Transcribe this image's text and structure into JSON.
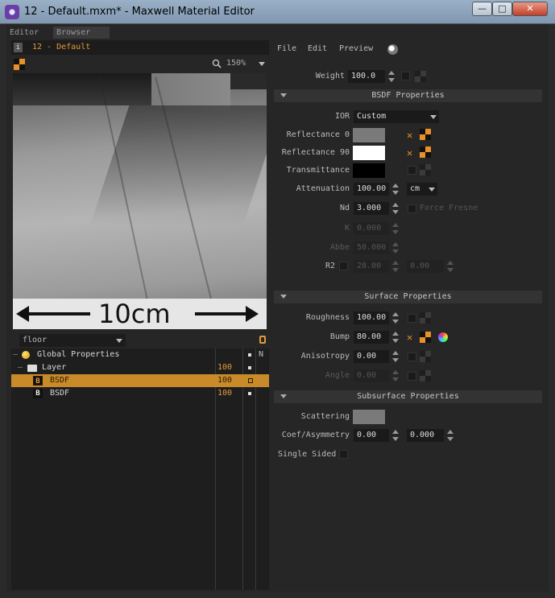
{
  "window": {
    "title": "12 - Default.mxm* - Maxwell Material Editor",
    "minimize": "—",
    "maximize": "□",
    "close": "✕"
  },
  "tabs": [
    "Editor",
    "Browser"
  ],
  "material": {
    "name": "12 - Default",
    "zoom": "150%"
  },
  "preview": {
    "scale_label": "10cm"
  },
  "layers": {
    "dropdown": "floor",
    "rows": [
      {
        "label": "Global Properties",
        "pct": "",
        "n": "N"
      },
      {
        "label": "Layer",
        "pct": "100",
        "n": ""
      },
      {
        "label": "BSDF",
        "pct": "100",
        "n": "",
        "badge": "B"
      },
      {
        "label": "BSDF",
        "pct": "100",
        "n": "",
        "badge": "B"
      }
    ]
  },
  "menu": [
    "File",
    "Edit",
    "Preview"
  ],
  "weight": {
    "label": "Weight",
    "value": "100.0"
  },
  "bsdf": {
    "title": "BSDF Properties",
    "ior_label": "IOR",
    "ior_value": "Custom",
    "reflectance0_label": "Reflectance 0",
    "reflectance90_label": "Reflectance 90",
    "transmittance_label": "Transmittance",
    "attenuation_label": "Attenuation",
    "attenuation_value": "100.00",
    "attenuation_unit": "cm",
    "nd_label": "Nd",
    "nd_value": "3.000",
    "force_fresnel": "Force Fresne",
    "k_label": "K",
    "k_value": "0.000",
    "abbe_label": "Abbe",
    "abbe_value": "50.000",
    "r2_label": "R2",
    "r2_value1": "28.00",
    "r2_value2": "0.00"
  },
  "surface": {
    "title": "Surface Properties",
    "roughness_label": "Roughness",
    "roughness_value": "100.00",
    "bump_label": "Bump",
    "bump_value": "80.00",
    "anisotropy_label": "Anisotropy",
    "anisotropy_value": "0.00",
    "angle_label": "Angle",
    "angle_value": "0.00"
  },
  "subsurface": {
    "title": "Subsurface Properties",
    "scattering_label": "Scattering",
    "coef_label": "Coef/Asymmetry",
    "coef_value1": "0.00",
    "coef_value2": "0.000",
    "single_sided_label": "Single Sided"
  },
  "colors": {
    "accent": "#e29a3a",
    "reflectance0": "#7a7a7a",
    "reflectance90": "#ffffff",
    "transmittance": "#000000",
    "scattering": "#7a7a7a"
  }
}
